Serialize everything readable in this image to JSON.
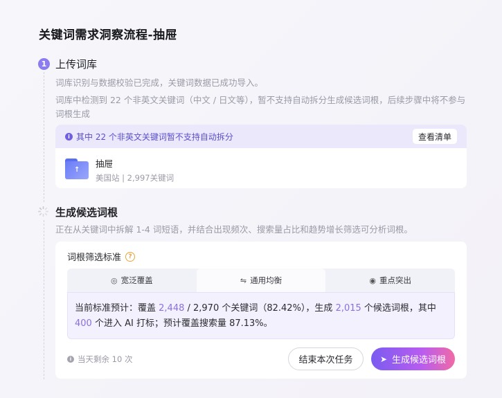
{
  "page_title": "关键词需求洞察流程-抽屉",
  "step1": {
    "number": "1",
    "title": "上传词库",
    "desc1": "词库识别与数据校验已完成，关键词数据已成功导入。",
    "desc2": "词库中检测到 22 个非英文关键词（中文 / 日文等），暂不支持自动拆分生成候选词根，后续步骤中将不参与词根生成",
    "warning_text": "其中 22 个非英文关键词暂不支持自动拆分",
    "view_list_label": "查看清单",
    "file_name": "抽屉",
    "file_meta": "美国站 | 2,997关键词"
  },
  "step2": {
    "title": "生成候选词根",
    "desc": "正在从关键词中拆解 1-4 词短语，并结合出现频次、搜索量占比和趋势增长筛选可分析词根。",
    "criteria_title": "词根筛选标准",
    "tabs": [
      {
        "label": "宽泛覆盖",
        "icon": "signal-icon"
      },
      {
        "label": "通用均衡",
        "icon": "sliders-icon"
      },
      {
        "label": "重点突出",
        "icon": "target-icon"
      }
    ],
    "active_tab": 1,
    "stats": {
      "prefix": "当前标准预计：覆盖 ",
      "covered": "2,448",
      "mid1": " / 2,970 个关键词（82.42%），生成 ",
      "generated": "2,015",
      "mid2": " 个候选词根，其中 ",
      "ai_count": "400",
      "suffix": " 个进入 AI 打标；预计覆盖搜索量 87.13%。"
    },
    "remaining": "当天剩余 10 次",
    "end_button": "结束本次任务",
    "generate_button": "生成候选词根"
  },
  "colors": {
    "accent": "#8b7cf0",
    "highlight_number": "#8b6fe0",
    "warning_bg": "#ebe8fb",
    "gradient_start": "#7a5cf0",
    "gradient_end": "#f06aa6"
  }
}
